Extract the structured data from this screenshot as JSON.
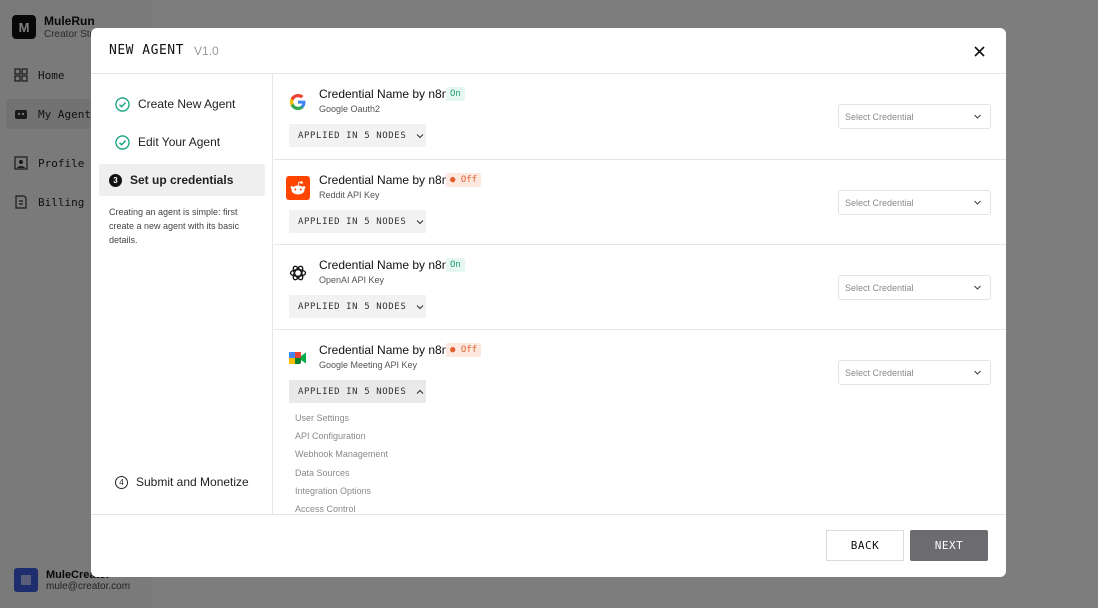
{
  "app": {
    "brand_name": "MuleRun",
    "brand_sub": "Creator Studio",
    "nav": [
      {
        "label": "Home",
        "icon": "grid-icon"
      },
      {
        "label": "My Agents",
        "icon": "robot-icon"
      },
      {
        "label": "Profile",
        "icon": "profile-icon"
      },
      {
        "label": "Billing",
        "icon": "billing-icon"
      }
    ],
    "user": {
      "name": "MuleCreator",
      "email": "mule@creator.com"
    }
  },
  "modal": {
    "title": "NEW AGENT",
    "version": "V1.0",
    "steps": [
      {
        "label": "Create New Agent",
        "state": "done"
      },
      {
        "label": "Edit Your Agent",
        "state": "done"
      },
      {
        "number": "3",
        "label": "Set up credentials",
        "state": "active"
      },
      {
        "number": "4",
        "label": "Submit and Monetize",
        "state": "pending"
      }
    ],
    "step_description": "Creating an agent is simple: first create a new agent with its basic details.",
    "credentials": [
      {
        "name": "Credential Name by n8n",
        "status": "On",
        "type": "Google Oauth2",
        "applied": "APPLIED IN 5 NODES",
        "select_placeholder": "Select Credential",
        "icon": "google-icon"
      },
      {
        "name": "Credential Name by n8n",
        "status": "Off",
        "type": "Reddit API Key",
        "applied": "APPLIED IN 5 NODES",
        "select_placeholder": "Select Credential",
        "icon": "reddit-icon"
      },
      {
        "name": "Credential Name by n8n",
        "status": "On",
        "type": "OpenAI API Key",
        "applied": "APPLIED IN 5 NODES",
        "select_placeholder": "Select Credential",
        "icon": "openai-icon"
      },
      {
        "name": "Credential Name by n8n",
        "status": "Off",
        "type": "Google Meeting API Key",
        "applied": "APPLIED IN 5 NODES",
        "select_placeholder": "Select Credential",
        "icon": "google-meet-icon",
        "nodes": [
          "User Settings",
          "API Configuration",
          "Webhook Management",
          "Data Sources",
          "Integration Options",
          "Access Control"
        ]
      }
    ],
    "back_label": "BACK",
    "next_label": "NEXT"
  },
  "colors": {
    "on": "#1f9d6c",
    "off": "#e35d2c",
    "check": "#14a37f",
    "next_bg": "#6b6b70"
  }
}
